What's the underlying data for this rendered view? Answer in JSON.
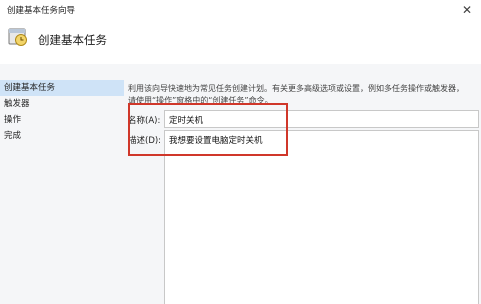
{
  "window": {
    "title": "创建基本任务向导"
  },
  "header": {
    "title": "创建基本任务"
  },
  "sidebar": {
    "steps": [
      {
        "label": "创建基本任务",
        "active": true
      },
      {
        "label": "触发器",
        "active": false
      },
      {
        "label": "操作",
        "active": false
      },
      {
        "label": "完成",
        "active": false
      }
    ]
  },
  "content": {
    "intro": "利用该向导快速地为常见任务创建计划。有关更多高级选项或设置，例如多任务操作或触发器，请使用“操作”窗格中的“创建任务”命令。",
    "name_label": "名称(A):",
    "name_value": "定时关机",
    "desc_label": "描述(D):",
    "desc_value": "我想要设置电脑定时关机"
  },
  "colors": {
    "highlight": "#d0372a",
    "selected_step": "#cfe3f7"
  }
}
